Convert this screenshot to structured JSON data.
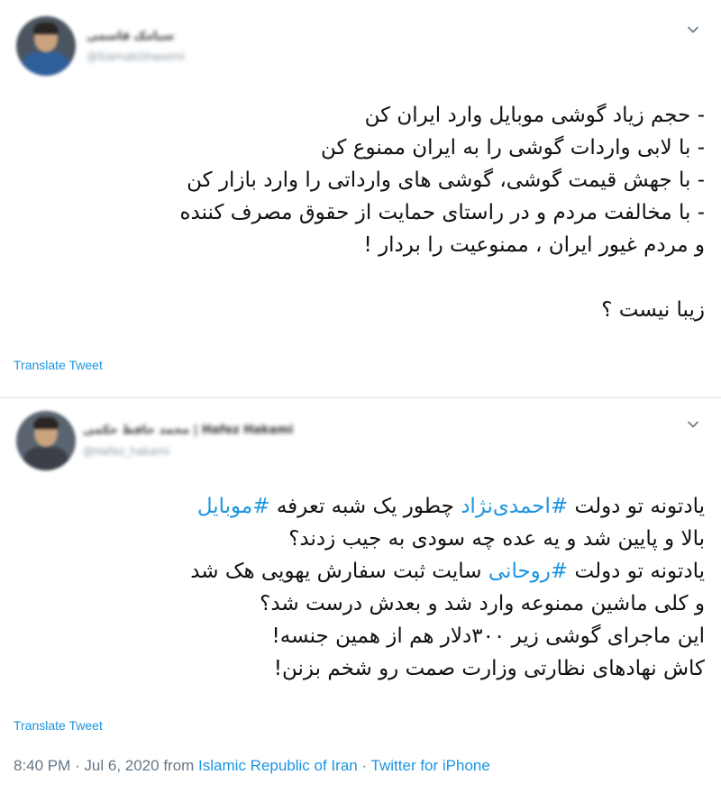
{
  "tweet1": {
    "user_name": "سیامک قاسمی",
    "user_handle": "@SiamakGhasemi",
    "lines": [
      "- حجم زیاد گوشی موبایل وارد ایران کن",
      "- با لابی واردات گوشی را به ایران ممنوع کن",
      "- با جهش قیمت گوشی، گوشی های وارداتی را وارد بازار کن",
      "- با مخالفت مردم و در راستای حمایت از حقوق مصرف کننده",
      "و مردم غیور ایران ، ممنوعیت را بردار !"
    ],
    "closing": "زیبا نیست ؟",
    "translate": "Translate Tweet"
  },
  "tweet2": {
    "user_name": "محمد حافظ حکمی | Hafez Hakami",
    "user_handle": "@Hafez_hakami",
    "line1": {
      "a": "یادتونه تو دولت ",
      "hashtag1": "#احمدی‌نژاد",
      "b": " چطور یک شبه تعرفه ",
      "hashtag2": "#موبایل"
    },
    "line2": "بالا و پایین شد و یه عده چه سودی به جیب زدند؟",
    "line3": {
      "a": "یادتونه تو دولت ",
      "hashtag": "#روحانی",
      "b": " سایت ثبت سفارش یهویی هک شد"
    },
    "line4": "و کلی ماشین ممنوعه وارد شد و بعدش درست شد؟",
    "line5": "این ماجرای گوشی زیر ۳۰۰دلار هم از همین جنسه!",
    "line6": "کاش نهادهای نظارتی وزارت صمت رو شخم بزنن!",
    "translate": "Translate Tweet",
    "meta": {
      "time": "8:40 PM · Jul 6, 2020 from ",
      "location": "Islamic Republic of Iran",
      "sep": " · ",
      "source": "Twitter for iPhone"
    }
  },
  "colors": {
    "link": "#1b95e0",
    "text": "#111111",
    "muted": "#657786",
    "divider": "#e6ecf0"
  },
  "icons": {
    "more": "chevron-down-icon"
  }
}
